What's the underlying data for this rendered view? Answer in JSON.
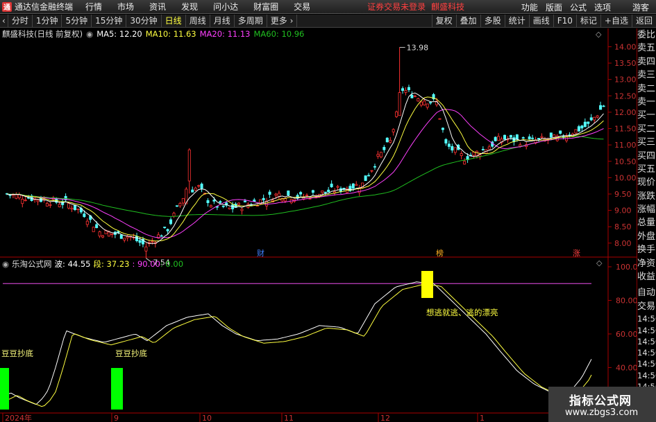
{
  "menubar": {
    "app": "通达信金融终端",
    "menus": [
      "行情",
      "市场",
      "资讯",
      "发现",
      "问小达",
      "财富圈",
      "交易"
    ],
    "warning": "证券交易未登录",
    "stock": "麒盛科技",
    "right": [
      "功能",
      "版面",
      "公式",
      "选项"
    ],
    "user": "游客"
  },
  "toolbar": {
    "periods": [
      "分时",
      "1分钟",
      "5分钟",
      "15分钟",
      "30分钟",
      "日线",
      "周线",
      "月线",
      "多周期",
      "更多"
    ],
    "active": "日线",
    "more_arrow": "›",
    "right": [
      "复权",
      "叠加",
      "多股",
      "统计",
      "画线",
      "F10",
      "标记",
      "+自选",
      "返回"
    ]
  },
  "legend": {
    "title": "麒盛科技(日线 前复权)",
    "ma5": "MA5: 12.20",
    "ma10": "MA10: 11.63",
    "ma20": "MA20: 11.13",
    "ma60": "MA60: 10.96"
  },
  "price_axis": [
    "14.00",
    "13.50",
    "13.00",
    "12.50",
    "12.00",
    "11.50",
    "11.00",
    "10.50",
    "10.00",
    "9.50",
    "9.00",
    "8.50",
    "8.00"
  ],
  "price_labels": {
    "high": "13.98",
    "low": "7.54"
  },
  "event_markers": [
    "财",
    "榜",
    "涨"
  ],
  "indicator": {
    "name": "乐淘公式网",
    "wave": "波: 44.55",
    "segment": "段: 37.23",
    "level1": ": 90.00",
    "level2": ": 0.00",
    "axis": [
      "100.0",
      "80.00",
      "60.00",
      "40.00",
      "20.00"
    ],
    "signals": [
      "豆豆抄底",
      "豆豆抄底"
    ],
    "top_text": "想逃就逃、逃的漂亮"
  },
  "date_axis": [
    "2024年",
    "9",
    "10",
    "11",
    "12",
    "1"
  ],
  "right_panel": {
    "top": [
      "委比",
      "卖五",
      "卖四",
      "卖三",
      "卖二",
      "卖一",
      "买一",
      "买二",
      "买三",
      "买四",
      "买五",
      "现价",
      "涨跌",
      "涨幅",
      "总量",
      "外盘",
      "换手",
      "净资",
      "收益"
    ],
    "bottom": [
      "自动",
      "交易",
      "14:56",
      "14:56",
      "14:56",
      "14:56",
      "14:56",
      "14:56",
      "14:56",
      "14:56"
    ]
  },
  "watermark": {
    "line1": "指标公式网",
    "line2": "www.zbgs3.com"
  },
  "colors": {
    "up": "#ff3232",
    "down": "#54ffff",
    "ma5": "#ffffff",
    "ma10": "#ffff40",
    "ma20": "#ff40ff",
    "ma60": "#20c020",
    "signal": "#00ff00",
    "top": "#ffff00"
  }
}
